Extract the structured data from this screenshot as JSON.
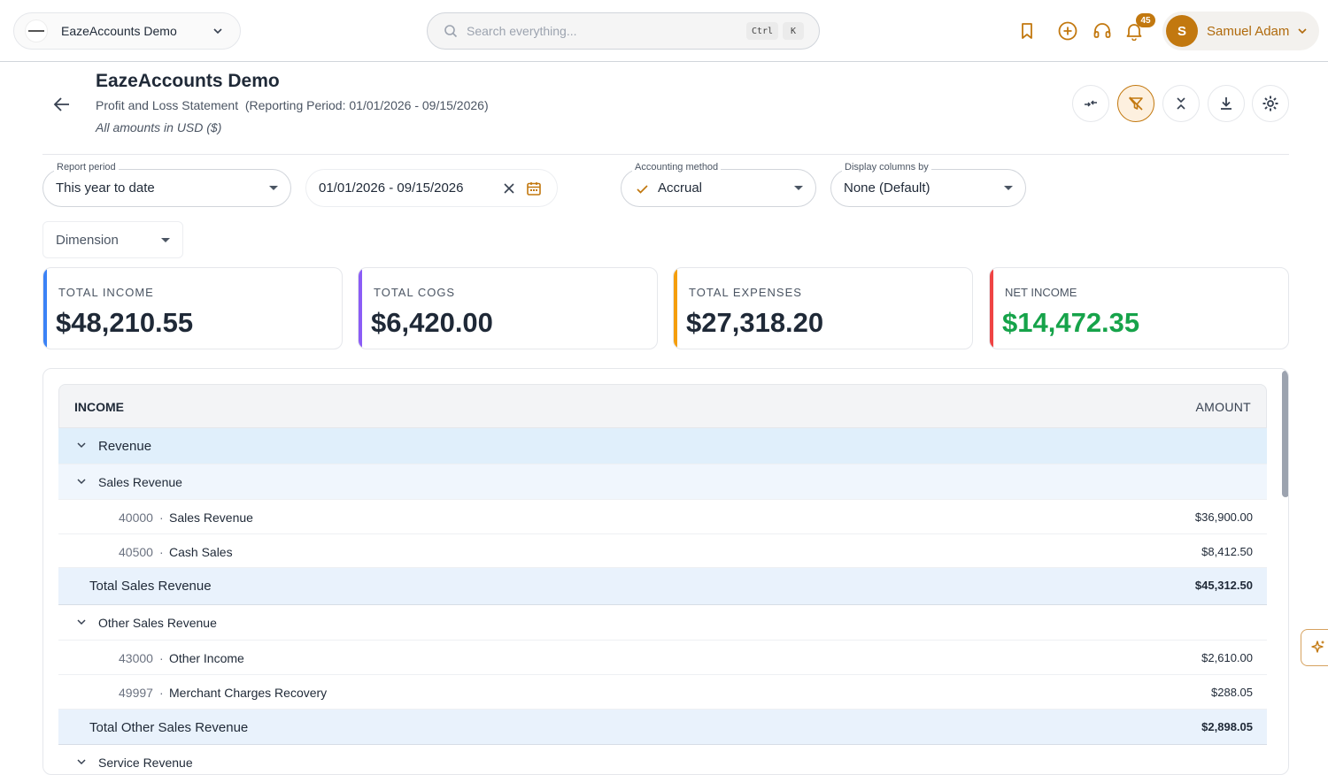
{
  "topbar": {
    "org_name": "EazeAccounts Demo",
    "search_placeholder": "Search everything...",
    "shortcut_ctrl": "Ctrl",
    "shortcut_key": "K",
    "notification_count": "45",
    "user_initial": "S",
    "user_name": "Samuel Adam",
    "accent_color": "#c2780f"
  },
  "header": {
    "title": "EazeAccounts Demo",
    "subtitle": "Profit and Loss Statement  (Reporting Period: 01/01/2026 - 09/15/2026)",
    "currency_note": "All amounts in USD ($)"
  },
  "filters": {
    "report_period_label": "Report period",
    "report_period_value": "This year to date",
    "date_range": "01/01/2026 - 09/15/2026",
    "accounting_method_label": "Accounting method",
    "accounting_method_value": "Accrual",
    "display_columns_label": "Display columns by",
    "display_columns_value": "None (Default)",
    "dimension": "Dimension"
  },
  "summary": [
    {
      "label": "TOTAL INCOME",
      "value": "$48,210.55",
      "color": "#3b82f6"
    },
    {
      "label": "TOTAL COGS",
      "value": "$6,420.00",
      "color": "#8b5cf6"
    },
    {
      "label": "TOTAL EXPENSES",
      "value": "$27,318.20",
      "color": "#f59e0b"
    },
    {
      "label": "NET INCOME",
      "value": "$14,472.35",
      "color": "#ef4444",
      "value_color": "#16a34a"
    }
  ],
  "table": {
    "col_left": "INCOME",
    "col_right": "AMOUNT",
    "rows": [
      {
        "type": "section",
        "name": "Revenue"
      },
      {
        "type": "group",
        "name": "Sales Revenue"
      },
      {
        "type": "account",
        "code": "40000",
        "name": "Sales Revenue",
        "amount": "$36,900.00"
      },
      {
        "type": "account",
        "code": "40500",
        "name": "Cash Sales",
        "amount": "$8,412.50"
      },
      {
        "type": "total",
        "name": "Total Sales Revenue",
        "amount": "$45,312.50"
      },
      {
        "type": "group",
        "name": "Other Sales Revenue"
      },
      {
        "type": "account",
        "code": "43000",
        "name": "Other Income",
        "amount": "$2,610.00"
      },
      {
        "type": "account",
        "code": "49997",
        "name": "Merchant Charges Recovery",
        "amount": "$288.05"
      },
      {
        "type": "total",
        "name": "Total Other Sales Revenue",
        "amount": "$2,898.05"
      },
      {
        "type": "group",
        "name": "Service Revenue"
      }
    ]
  }
}
